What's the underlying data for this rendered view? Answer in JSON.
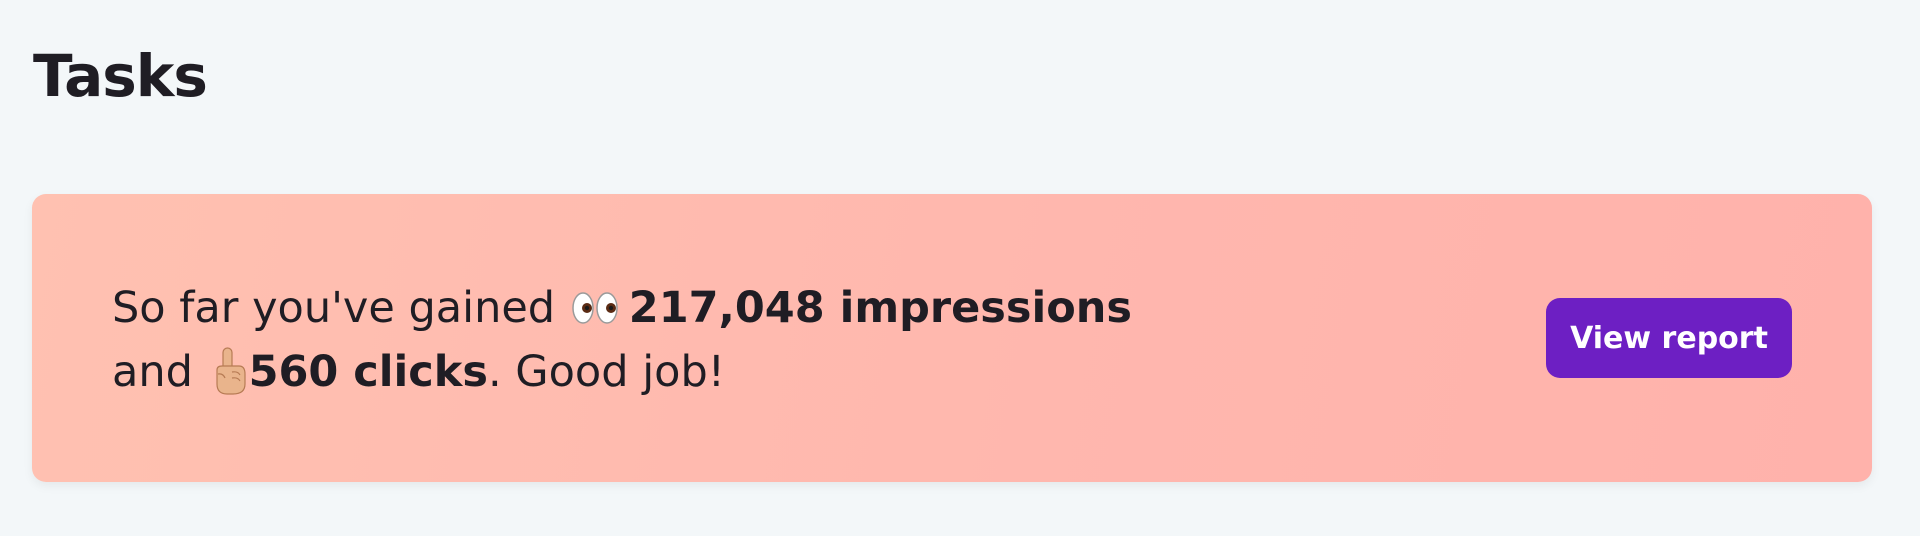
{
  "page": {
    "title": "Tasks"
  },
  "banner": {
    "text_before_impressions": "So far you've gained ",
    "impressions_icon": "eyes-emoji",
    "impressions": "217,048 impressions",
    "text_and": "and ",
    "clicks_icon": "pointing-up-emoji",
    "clicks": "560 clicks",
    "text_after_clicks": ". Good job!",
    "button_label": "View report",
    "colors": {
      "background_start": "#ffc1b1",
      "background_end": "#ffb2ab",
      "button": "#6d1fc3",
      "button_text": "#ffffff"
    }
  }
}
